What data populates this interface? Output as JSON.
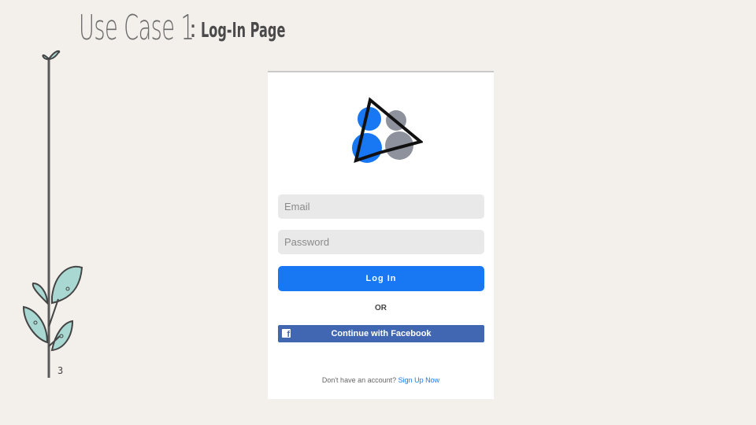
{
  "slide": {
    "title_main": "Use Case 1",
    "title_colon": ":",
    "title_sub": "Log-In Page",
    "page_number": "3"
  },
  "login": {
    "email_placeholder": "Email",
    "password_placeholder": "Password",
    "login_label": "Log In",
    "or_text": "OR",
    "facebook_label": "Continue with Facebook",
    "signup_prompt": "Don't have an account?",
    "signup_link": "Sign Up Now"
  },
  "colors": {
    "primary_blue": "#1877f2",
    "facebook_blue": "#4267b2",
    "logo_gray": "#8e929c"
  },
  "icons": {
    "app_logo": "app-logo-icon",
    "facebook": "facebook-icon",
    "decoration": "vine-decoration"
  }
}
